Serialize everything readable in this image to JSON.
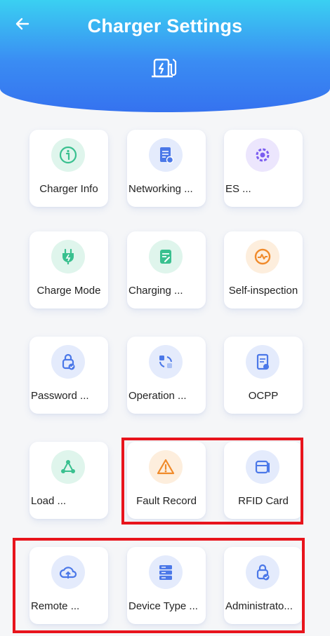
{
  "header": {
    "title": "Charger Settings",
    "back_icon": "arrow-left-icon",
    "charger_icon": "charger-station-icon"
  },
  "tiles": [
    {
      "label": "Charger Info",
      "icon": "info-icon",
      "color": "#39c08f"
    },
    {
      "label": "Networking ...",
      "icon": "network-settings-icon",
      "color": "#4b78e8"
    },
    {
      "label": "ES ...",
      "icon": "gear-icon",
      "color": "#7a5cf0"
    },
    {
      "label": "Charge Mode",
      "icon": "plug-icon",
      "color": "#39c08f"
    },
    {
      "label": "Charging ...",
      "icon": "document-edit-icon",
      "color": "#39c08f"
    },
    {
      "label": "Self-inspection",
      "icon": "pulse-check-icon",
      "color": "#f08a2a"
    },
    {
      "label": "Password ...",
      "icon": "lock-shield-icon",
      "color": "#4b78e8"
    },
    {
      "label": "Operation ...",
      "icon": "sync-icon",
      "color": "#4b78e8"
    },
    {
      "label": "OCPP",
      "icon": "document-settings-icon",
      "color": "#4b78e8"
    },
    {
      "label": "Load ...",
      "icon": "share-nodes-icon",
      "color": "#39c08f"
    },
    {
      "label": "Fault Record",
      "icon": "warning-icon",
      "color": "#f08a2a"
    },
    {
      "label": "RFID Card",
      "icon": "card-icon",
      "color": "#4b78e8"
    },
    {
      "label": "Remote ...",
      "icon": "cloud-upload-icon",
      "color": "#4b78e8"
    },
    {
      "label": "Device Type ...",
      "icon": "server-icon",
      "color": "#4b78e8"
    },
    {
      "label": "Administrato...",
      "icon": "admin-lock-icon",
      "color": "#4b78e8"
    }
  ],
  "highlight_color": "#e8141c"
}
